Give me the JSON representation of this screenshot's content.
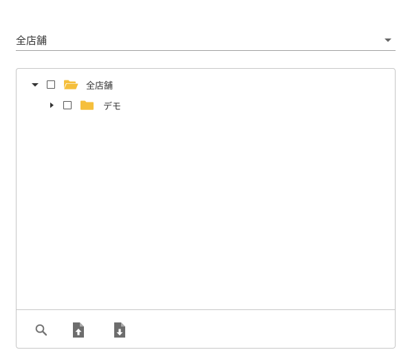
{
  "store_select": {
    "value": "全店舗",
    "caret_icon": "caret-down-icon"
  },
  "tree": {
    "root": {
      "label": "全店舗",
      "expanded": true,
      "checked": false,
      "folder_state": "open",
      "toggle_icon": "caret-down-icon",
      "folder_icon": "folder-open-icon"
    },
    "children": [
      {
        "label": "デモ",
        "expanded": false,
        "checked": false,
        "folder_state": "closed",
        "toggle_icon": "caret-right-icon",
        "folder_icon": "folder-icon"
      }
    ]
  },
  "footer": {
    "buttons": [
      {
        "icon": "search-icon",
        "color": "#757575"
      },
      {
        "icon": "file-upload-icon",
        "color": "#6d6d6d"
      },
      {
        "icon": "file-download-icon",
        "color": "#6d6d6d"
      }
    ]
  },
  "colors": {
    "folder": "#f5bf3c",
    "border": "#c6c6c6",
    "underline": "#9e9e9e",
    "text": "#333333"
  }
}
